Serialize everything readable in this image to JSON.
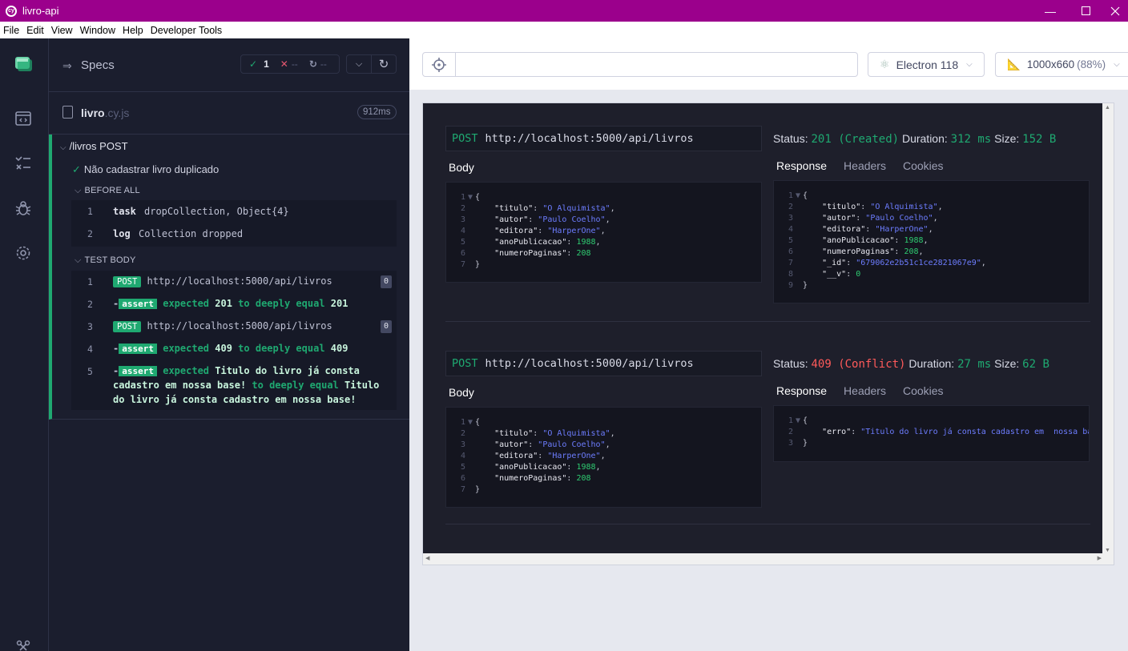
{
  "window": {
    "title": "livro-api",
    "app_icon": "cy"
  },
  "menu": [
    "File",
    "Edit",
    "View",
    "Window",
    "Help",
    "Developer Tools"
  ],
  "reporter": {
    "specs_label": "Specs",
    "stats": {
      "passed": "1",
      "failed": "--",
      "pending": "--"
    },
    "file": {
      "name": "livro",
      "ext": ".cy.js",
      "duration": "912ms"
    },
    "suite_title": "/livros POST",
    "test_title": "Não cadastrar livro duplicado",
    "before_all_label": "BEFORE ALL",
    "before_all": [
      {
        "num": "1",
        "name": "task",
        "msg": "dropCollection, Object{4}"
      },
      {
        "num": "2",
        "name": "log",
        "msg": "Collection dropped"
      }
    ],
    "test_body_label": "TEST BODY",
    "test_body": {
      "c1": {
        "num": "1",
        "method": "POST",
        "url": "http://localhost:5000/api/livros",
        "count": "0"
      },
      "c2": {
        "num": "2",
        "badge": "assert",
        "w1": "expected",
        "v1": "201",
        "w2": "to deeply equal",
        "v2": "201"
      },
      "c3": {
        "num": "3",
        "method": "POST",
        "url": "http://localhost:5000/api/livros",
        "count": "0"
      },
      "c4": {
        "num": "4",
        "badge": "assert",
        "w1": "expected",
        "v1": "409",
        "w2": "to deeply equal",
        "v2": "409"
      },
      "c5": {
        "num": "5",
        "badge": "assert",
        "w1": "expected",
        "l1": "Titulo do livro já consta",
        "l2a": "cadastro em nossa base!",
        "l2b": "to deeply equal",
        "l2c": "Titulo",
        "l3": "do livro já consta cadastro em nossa base!"
      }
    }
  },
  "toolbar": {
    "browser": "Electron 118",
    "viewport": "1000x660",
    "zoom": "(88%)"
  },
  "requests": [
    {
      "method": "POST",
      "url": "http://localhost:5000/api/livros",
      "status_label": "Status:",
      "status": "201 (Created)",
      "duration_label": "Duration:",
      "duration": "312 ms",
      "size_label": "Size:",
      "size": "152 B",
      "body_label": "Body",
      "tabs": [
        "Response",
        "Headers",
        "Cookies"
      ],
      "body": {
        "titulo": "\"O Alquimista\"",
        "autor": "\"Paulo Coelho\"",
        "editora": "\"HarperOne\"",
        "anoPublicacao": "1988",
        "numeroPaginas": "208"
      },
      "response": {
        "titulo": "\"O Alquimista\"",
        "autor": "\"Paulo Coelho\"",
        "editora": "\"HarperOne\"",
        "anoPublicacao": "1988",
        "numeroPaginas": "208",
        "_id": "\"679062e2b51c1ce2821067e9\"",
        "__v": "0"
      }
    },
    {
      "method": "POST",
      "url": "http://localhost:5000/api/livros",
      "status_label": "Status:",
      "status": "409 (Conflict)",
      "duration_label": "Duration:",
      "duration": "27 ms",
      "size_label": "Size:",
      "size": "62 B",
      "body_label": "Body",
      "tabs": [
        "Response",
        "Headers",
        "Cookies"
      ],
      "body": {
        "titulo": "\"O Alquimista\"",
        "autor": "\"Paulo Coelho\"",
        "editora": "\"HarperOne\"",
        "anoPublicacao": "1988",
        "numeroPaginas": "208"
      },
      "response": {
        "erro": "\"Titulo do livro já consta cadastro em  nossa base!\""
      }
    }
  ],
  "code_tokens": {
    "open": "{",
    "close": "}",
    "fold": "▼"
  },
  "colors": {
    "titlebar": "#9b008c",
    "pass": "#1fa971",
    "fail": "#e45770",
    "conflict": "#ff5a5a"
  }
}
